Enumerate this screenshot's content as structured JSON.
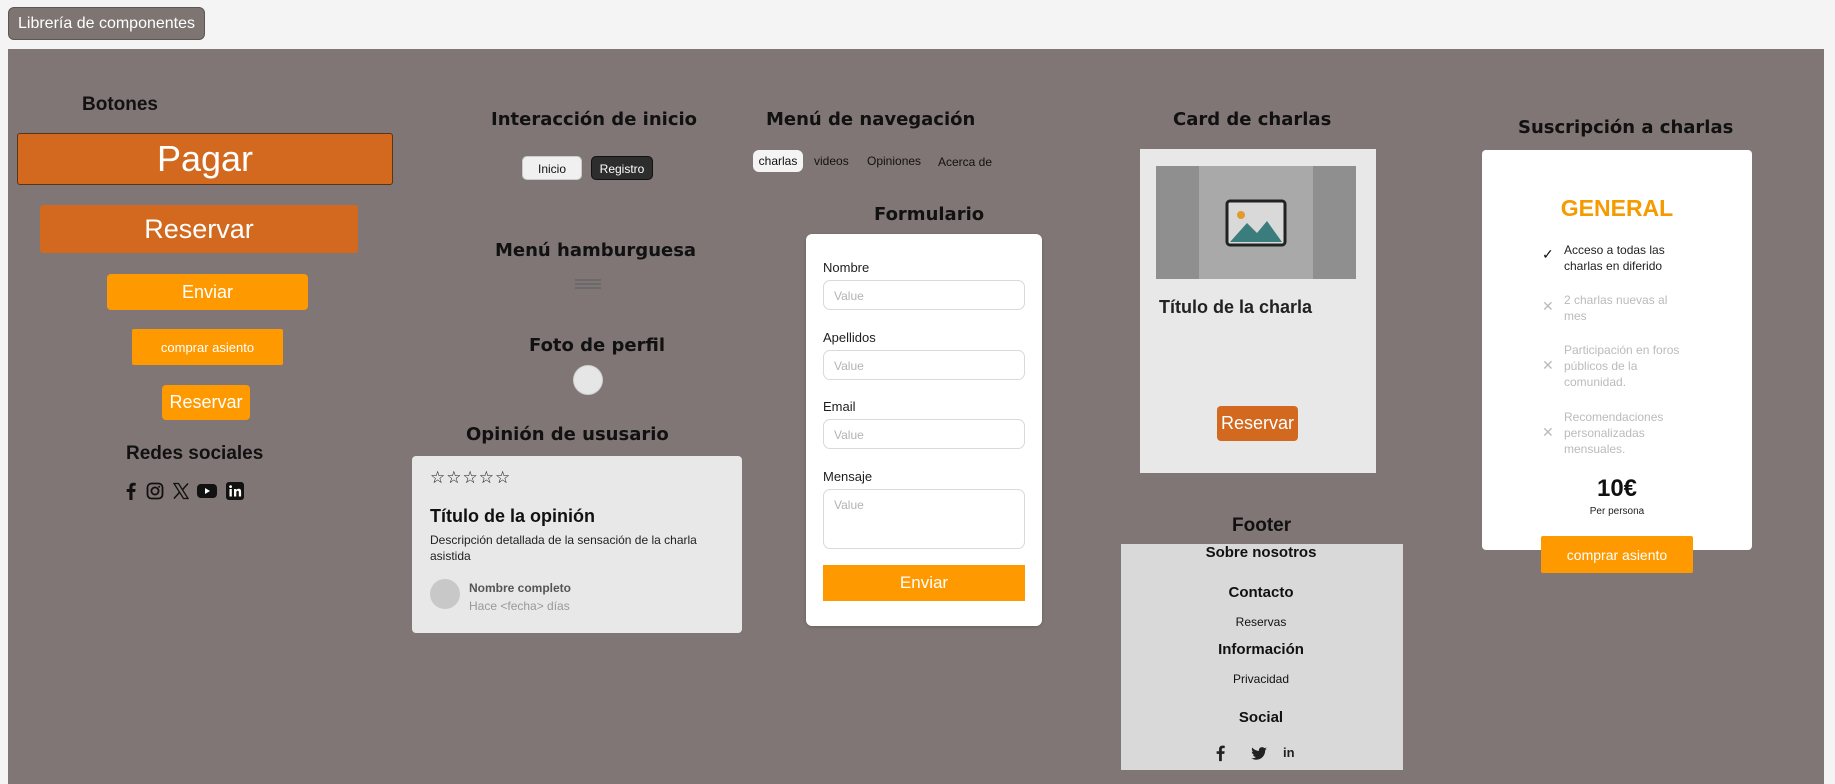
{
  "window": {
    "tag": "Librería de componentes"
  },
  "buttons_section": {
    "title": "Botones",
    "pagar": "Pagar",
    "reservar_large": "Reservar",
    "enviar": "Enviar",
    "comprar": "comprar asiento",
    "reservar_small": "Reservar"
  },
  "social": {
    "title": "Redes sociales"
  },
  "inicio": {
    "title": "Interacción de  inicio",
    "inicio": "Inicio",
    "registro": "Registro"
  },
  "hamburger": {
    "title": "Menú hamburguesa"
  },
  "profile": {
    "title": "Foto de perfil"
  },
  "review": {
    "title": "Opinión de ususario",
    "card_title": "Título de la opinión",
    "description": "Descripción detallada de la sensación de la charla asistida",
    "name": "Nombre completo",
    "date": "Hace <fecha> días",
    "stars": "☆☆☆☆☆"
  },
  "navmenu": {
    "title": "Menú de navegación",
    "items": [
      "charlas",
      "videos",
      "Opiniones",
      "Acerca de"
    ]
  },
  "form": {
    "title": "Formulario",
    "fields": [
      {
        "label": "Nombre",
        "placeholder": "Value"
      },
      {
        "label": "Apellidos",
        "placeholder": "Value"
      },
      {
        "label": "Email",
        "placeholder": "Value"
      },
      {
        "label": "Mensaje",
        "placeholder": "Value"
      }
    ],
    "submit": "Enviar"
  },
  "talk_card": {
    "title": "Card de charlas",
    "card_title": "Título de la charla",
    "button": "Reservar"
  },
  "footer": {
    "title": "Footer",
    "about": "Sobre nosotros",
    "contact": "Contacto",
    "reservas": "Reservas",
    "info": "Información",
    "privacy": "Privacidad",
    "social": "Social"
  },
  "subscription": {
    "title": "Suscripción a charlas",
    "plan": "GENERAL",
    "features": [
      {
        "text": "Acceso a todas las charlas en diferido",
        "included": true
      },
      {
        "text": "2 charlas nuevas al mes",
        "included": false
      },
      {
        "text": "Participación en foros públicos de la comunidad.",
        "included": false
      },
      {
        "text": "Recomendaciones personalizadas mensuales.",
        "included": false
      }
    ],
    "price": "10€",
    "per": "Per persona",
    "button": "comprar asiento"
  },
  "colors": {
    "canvas": "#807675",
    "orange": "#ff9900",
    "dark_orange": "#d2691e",
    "accent_text": "#f59b00"
  }
}
